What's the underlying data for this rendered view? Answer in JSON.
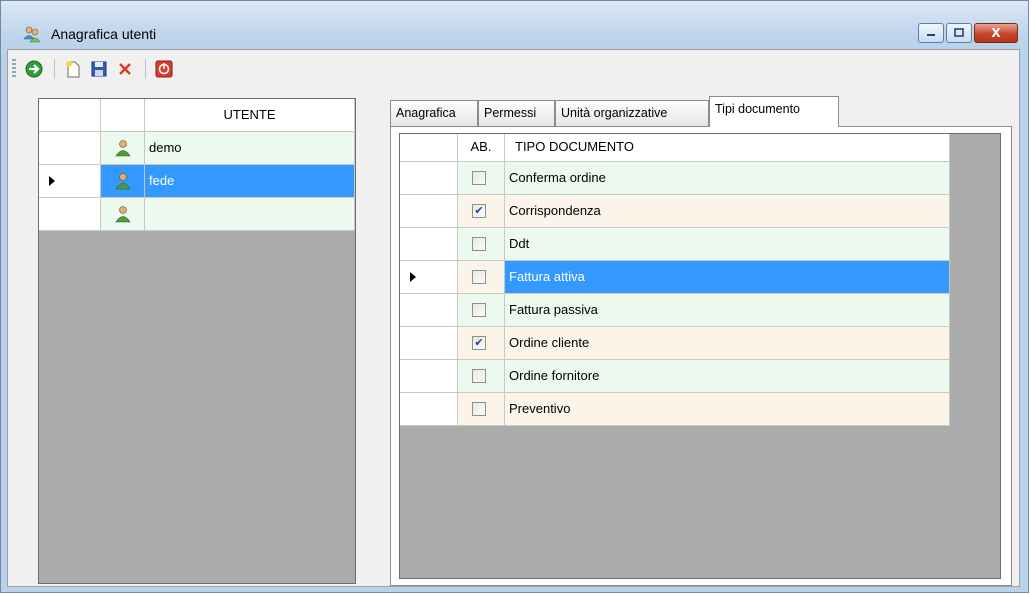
{
  "window": {
    "title": "Anagrafica utenti",
    "close_glyph": "X"
  },
  "toolbar": {
    "buttons": [
      {
        "icon": "go-arrow-icon"
      },
      {
        "icon": "new-document-icon"
      },
      {
        "icon": "save-disk-icon"
      },
      {
        "icon": "delete-x-icon"
      },
      {
        "icon": "exit-power-icon"
      }
    ]
  },
  "users": {
    "header": "UTENTE",
    "rows": [
      {
        "name": "demo"
      },
      {
        "name": "fede",
        "selected": true
      },
      {
        "name": ""
      }
    ]
  },
  "tabs": [
    {
      "label": "Anagrafica"
    },
    {
      "label": "Permessi"
    },
    {
      "label": "Unità organizzative"
    },
    {
      "label": "Tipi documento",
      "active": true
    }
  ],
  "documents": {
    "col_ab": "AB.",
    "col_tipo": "TIPO DOCUMENTO",
    "rows": [
      {
        "label": "Conferma ordine",
        "checked": false
      },
      {
        "label": "Corrispondenza",
        "checked": true
      },
      {
        "label": "Ddt",
        "checked": false
      },
      {
        "label": "Fattura attiva",
        "checked": false,
        "selected": true
      },
      {
        "label": "Fattura passiva",
        "checked": false
      },
      {
        "label": "Ordine cliente",
        "checked": true
      },
      {
        "label": "Ordine fornitore",
        "checked": false
      },
      {
        "label": "Preventivo",
        "checked": false
      }
    ]
  },
  "colors": {
    "row_green": "#ebf9ee",
    "row_beige": "#fbf4e9",
    "selection": "#3399ff",
    "grid_bg": "#ababab"
  }
}
